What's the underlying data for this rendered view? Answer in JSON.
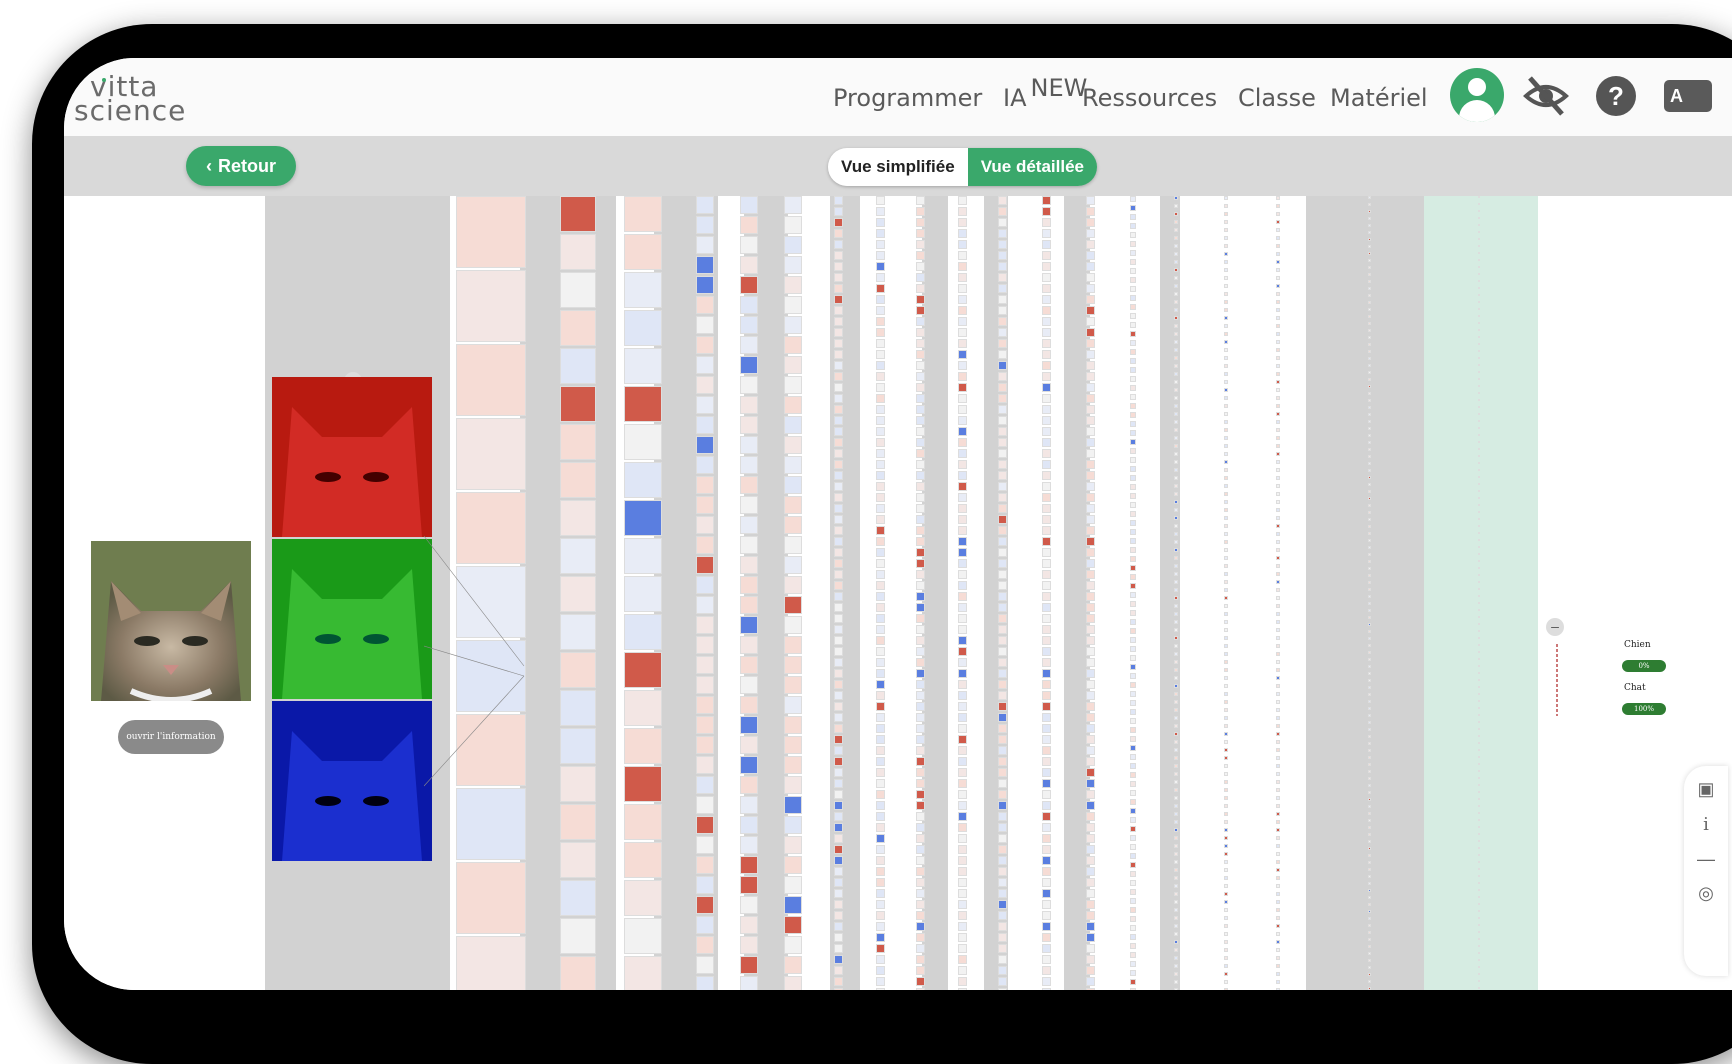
{
  "app": {
    "logo_line1": "vitta",
    "logo_line2": "science"
  },
  "nav": {
    "items": [
      {
        "label": "Programmer"
      },
      {
        "label": "IA",
        "badge": "NEW"
      },
      {
        "label": "Ressources"
      },
      {
        "label": "Classe"
      },
      {
        "label": "Matériel"
      }
    ],
    "help_label": "?",
    "lang_label": "A"
  },
  "toolbar": {
    "back_label": "Retour",
    "view_simple": "Vue simplifiée",
    "view_detailed": "Vue détaillée",
    "active_view": "Vue détaillée"
  },
  "network": {
    "info_button": "ouvrir l'information",
    "predictions": [
      {
        "label": "Chien",
        "value": "0%"
      },
      {
        "label": "Chat",
        "value": "100%"
      }
    ]
  },
  "colors": {
    "accent": "#3aa86b",
    "prediction_bar": "#2e7d32",
    "positive_activation": "#d05a4a",
    "negative_activation": "#5a7ee0"
  },
  "icons": [
    "user-avatar-icon",
    "eye-slash-icon",
    "help-icon",
    "translate-icon",
    "chevron-left-icon",
    "camera-icon",
    "info-icon",
    "zoom-out-icon",
    "recenter-icon"
  ]
}
